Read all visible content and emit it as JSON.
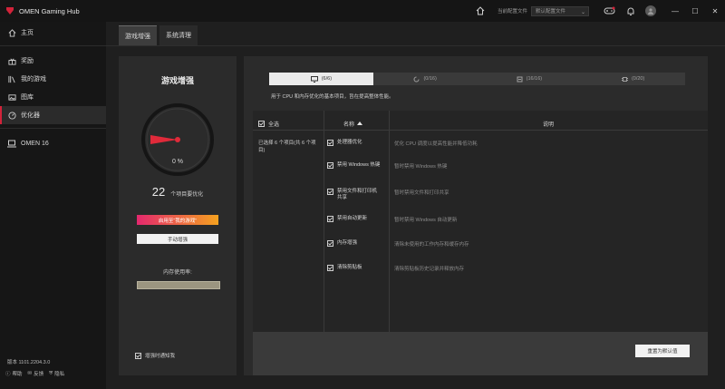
{
  "titlebar": {
    "app_title": "OMEN Gaming Hub",
    "profile_label": "当前配置文件",
    "profile_value": "默认配置文件",
    "icons": [
      "home-icon",
      "gamepad-icon",
      "bell-icon",
      "avatar",
      "minimize-icon",
      "maximize-icon",
      "close-icon"
    ],
    "accent": "#d3233a"
  },
  "sidebar": {
    "items": [
      {
        "label": "主页",
        "icon": "home-icon"
      },
      {
        "label": "奖励",
        "icon": "gift-icon"
      },
      {
        "label": "我的游戏",
        "icon": "library-icon"
      },
      {
        "label": "图库",
        "icon": "gallery-icon"
      },
      {
        "label": "优化器",
        "icon": "optimizer-icon",
        "active": true
      }
    ],
    "device": {
      "label": "OMEN 16",
      "icon": "laptop-icon"
    },
    "version": "版本 1101.2204.3.0",
    "bottom": [
      {
        "label": "帮助",
        "icon": "help-icon"
      },
      {
        "label": "反馈",
        "icon": "feedback-icon"
      },
      {
        "label": "隐私",
        "icon": "privacy-icon"
      }
    ]
  },
  "tabs": [
    {
      "label": "游戏增强",
      "active": true
    },
    {
      "label": "系统清理",
      "active": false
    }
  ],
  "left_panel": {
    "title": "游戏增强",
    "gauge_value": "0 %",
    "gauge_fraction": 0,
    "count": "22",
    "count_label": "个项目要优化",
    "primary_button": "启用至“我的游戏”",
    "secondary_button": "手动增强",
    "memory_label": "内存使用率:",
    "checkbox_label": "增强时通知我"
  },
  "right_panel": {
    "segments": [
      {
        "label": "(6/6)",
        "icon": "monitor-icon",
        "active": true
      },
      {
        "label": "(0/16)",
        "icon": "refresh-icon",
        "active": false
      },
      {
        "label": "(16/16)",
        "icon": "chip-icon",
        "active": false
      },
      {
        "label": "(0/20)",
        "icon": "cpu-icon",
        "active": false
      }
    ],
    "description": "用于 CPU 和内存优化的基本项目，旨在提高整体性能。",
    "headers": {
      "select_all": "全选",
      "name": "名称",
      "desc": "说明"
    },
    "selected_info": "已选择 6 个项目(共 6 个项目)",
    "rows": [
      {
        "name": "处理器优化",
        "desc": "优化 CPU 调度以提高性能并降低功耗"
      },
      {
        "name": "禁用 Windows 热键",
        "desc": "暂时禁用 Windows 热键"
      },
      {
        "name": "禁用文件和打印机共享",
        "desc": "暂时禁用文件和打印共享"
      },
      {
        "name": "禁用自动更新",
        "desc": "暂时禁用 Windows 自动更新"
      },
      {
        "name": "内存增强",
        "desc": "清除未使用的工作内存和缓存内存"
      },
      {
        "name": "清除剪贴板",
        "desc": "清除剪贴板历史记录并释放内存"
      }
    ],
    "reset_button": "重置为默认值"
  }
}
